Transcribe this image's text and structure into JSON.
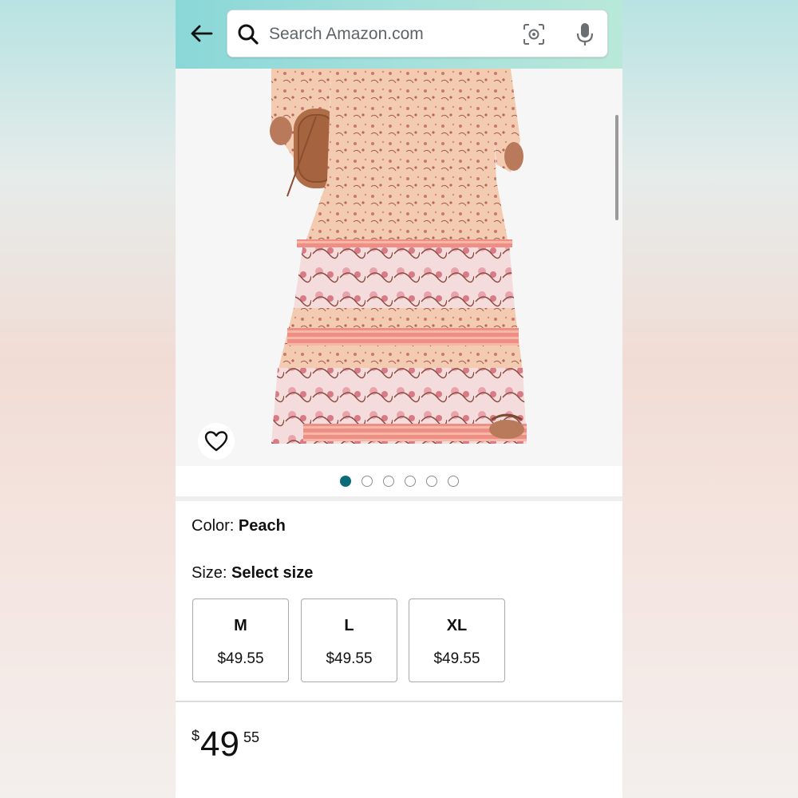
{
  "search": {
    "placeholder": "Search Amazon.com"
  },
  "product": {
    "color_label": "Color: ",
    "color_value": "Peach",
    "size_label": "Size: ",
    "size_value": "Select size",
    "sizes": [
      {
        "name": "M",
        "price": "$49.55"
      },
      {
        "name": "L",
        "price": "$49.55"
      },
      {
        "name": "XL",
        "price": "$49.55"
      }
    ],
    "price": {
      "currency": "$",
      "whole": "49",
      "fraction": "55"
    }
  },
  "carousel": {
    "total_images": 6,
    "active_index": 0
  },
  "colors": {
    "header_gradient_start": "#8ad7d8",
    "header_gradient_end": "#b9e8d8",
    "active_dot": "#0b6c79"
  },
  "icons": [
    "back-arrow-icon",
    "search-icon",
    "camera-lens-icon",
    "microphone-icon",
    "heart-icon"
  ]
}
